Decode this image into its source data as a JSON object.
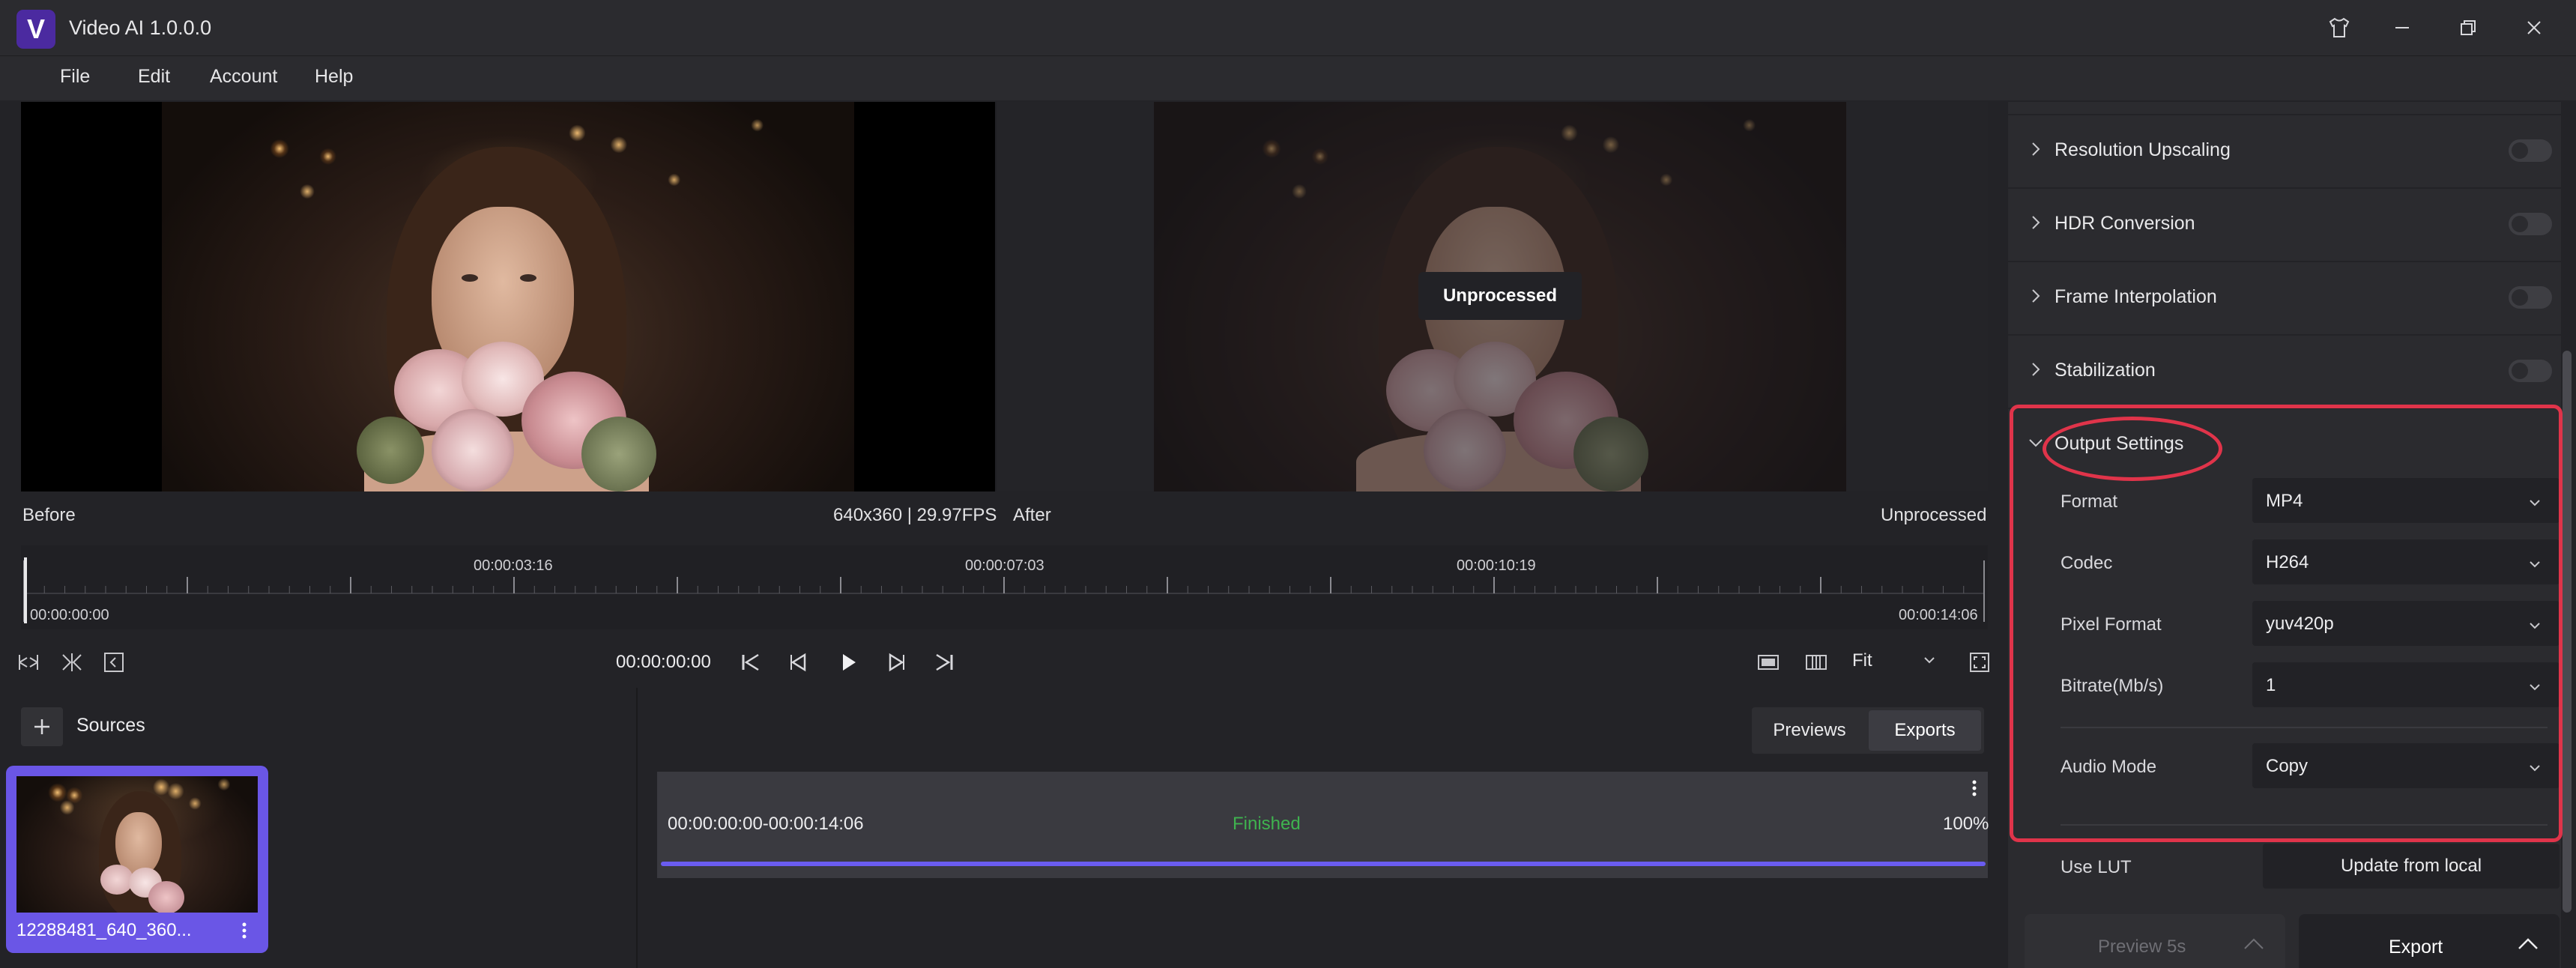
{
  "app": {
    "title": "Video AI 1.0.0.0",
    "logo_letter": "V",
    "accent": "#6a56e6"
  },
  "menu": {
    "items": [
      "File",
      "Edit",
      "Account",
      "Help"
    ]
  },
  "preview": {
    "before_label": "Before",
    "after_label": "After",
    "info": "640x360 | 29.97FPS",
    "status_right": "Unprocessed",
    "badge": "Unprocessed"
  },
  "timeline": {
    "ticks": [
      "00:00:03:16",
      "00:00:07:03",
      "00:00:10:19"
    ],
    "start": "00:00:00:00",
    "end": "00:00:14:06",
    "playhead_fraction": 0
  },
  "controls": {
    "timecode": "00:00:00:00",
    "zoom": "Fit"
  },
  "sources": {
    "title": "Sources",
    "items": [
      {
        "name": "12288481_640_360..."
      }
    ]
  },
  "exports": {
    "tabs": [
      "Previews",
      "Exports"
    ],
    "active_tab": "Exports",
    "rows": [
      {
        "range": "00:00:00:00-00:00:14:06",
        "status": "Finished",
        "percent": "100%",
        "progress_fraction": 1.0
      }
    ]
  },
  "settings": {
    "sections": [
      {
        "title": "Resolution Upscaling",
        "enabled": false
      },
      {
        "title": "HDR Conversion",
        "enabled": false
      },
      {
        "title": "Frame Interpolation",
        "enabled": false
      },
      {
        "title": "Stabilization",
        "enabled": false
      }
    ],
    "output": {
      "title": "Output Settings",
      "fields": [
        {
          "label": "Format",
          "value": "MP4"
        },
        {
          "label": "Codec",
          "value": "H264"
        },
        {
          "label": "Pixel Format",
          "value": "yuv420p"
        },
        {
          "label": "Bitrate(Mb/s)",
          "value": "1"
        },
        {
          "label": "Audio Mode",
          "value": "Copy"
        }
      ],
      "lut_label": "Use LUT",
      "lut_button": "Update from local"
    },
    "preview_button": "Preview 5s",
    "export_button": "Export",
    "highlight_color": "#e0344a"
  }
}
